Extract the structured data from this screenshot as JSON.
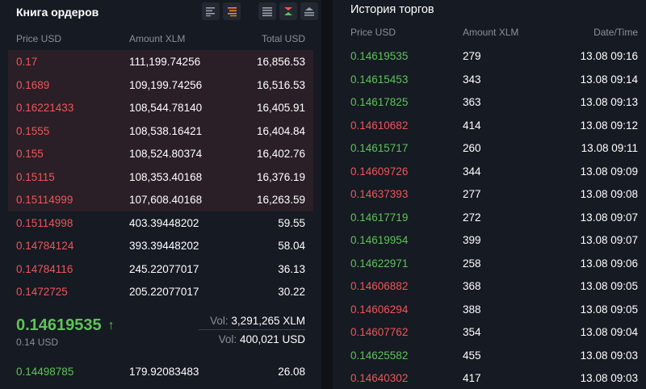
{
  "orderbook": {
    "title": "Книга ордеров",
    "columns": {
      "price": "Price USD",
      "amount": "Amount XLM",
      "total": "Total USD"
    },
    "asks": [
      {
        "price": "0.17",
        "amount": "111,199.74256",
        "total": "16,856.53",
        "highlight": true
      },
      {
        "price": "0.1689",
        "amount": "109,199.74256",
        "total": "16,516.53",
        "highlight": true
      },
      {
        "price": "0.16221433",
        "amount": "108,544.78140",
        "total": "16,405.91",
        "highlight": true
      },
      {
        "price": "0.1555",
        "amount": "108,538.16421",
        "total": "16,404.84",
        "highlight": true
      },
      {
        "price": "0.155",
        "amount": "108,524.80374",
        "total": "16,402.76",
        "highlight": true
      },
      {
        "price": "0.15115",
        "amount": "108,353.40168",
        "total": "16,376.19",
        "highlight": true
      },
      {
        "price": "0.15114999",
        "amount": "107,608.40168",
        "total": "16,263.59",
        "highlight": true
      },
      {
        "price": "0.15114998",
        "amount": "403.39448202",
        "total": "59.55",
        "highlight": false
      },
      {
        "price": "0.14784124",
        "amount": "393.39448202",
        "total": "58.04",
        "highlight": false
      },
      {
        "price": "0.14784116",
        "amount": "245.22077017",
        "total": "36.13",
        "highlight": false
      },
      {
        "price": "0.1472725",
        "amount": "205.22077017",
        "total": "30.22",
        "highlight": false
      }
    ],
    "last_price": "0.14619535",
    "last_price_arrow": "↑",
    "last_price_usd": "0.14 USD",
    "vol_label": "Vol:",
    "vol_xlm": "3,291,265 XLM",
    "vol_usd": "400,021 USD",
    "bids": [
      {
        "price": "0.14498785",
        "amount": "179.92083483",
        "total": "26.08"
      }
    ],
    "colors": {
      "ask": "#f0555a",
      "bid": "#5dc35a",
      "ask_highlight": "#2a1f26"
    }
  },
  "history": {
    "title": "История торгов",
    "columns": {
      "price": "Price USD",
      "amount": "Amount XLM",
      "time": "Date/Time"
    },
    "trades": [
      {
        "price": "0.14619535",
        "amount": "279",
        "time": "13.08 09:16",
        "side": "buy"
      },
      {
        "price": "0.14615453",
        "amount": "343",
        "time": "13.08 09:14",
        "side": "buy"
      },
      {
        "price": "0.14617825",
        "amount": "363",
        "time": "13.08 09:13",
        "side": "buy"
      },
      {
        "price": "0.14610682",
        "amount": "414",
        "time": "13.08 09:12",
        "side": "sell"
      },
      {
        "price": "0.14615717",
        "amount": "260",
        "time": "13.08 09:11",
        "side": "buy"
      },
      {
        "price": "0.14609726",
        "amount": "344",
        "time": "13.08 09:09",
        "side": "sell"
      },
      {
        "price": "0.14637393",
        "amount": "277",
        "time": "13.08 09:08",
        "side": "sell"
      },
      {
        "price": "0.14617719",
        "amount": "272",
        "time": "13.08 09:07",
        "side": "buy"
      },
      {
        "price": "0.14619954",
        "amount": "399",
        "time": "13.08 09:07",
        "side": "buy"
      },
      {
        "price": "0.14622971",
        "amount": "258",
        "time": "13.08 09:06",
        "side": "buy"
      },
      {
        "price": "0.14606882",
        "amount": "368",
        "time": "13.08 09:05",
        "side": "sell"
      },
      {
        "price": "0.14606294",
        "amount": "388",
        "time": "13.08 09:05",
        "side": "sell"
      },
      {
        "price": "0.14607762",
        "amount": "354",
        "time": "13.08 09:04",
        "side": "sell"
      },
      {
        "price": "0.14625582",
        "amount": "455",
        "time": "13.08 09:03",
        "side": "buy"
      },
      {
        "price": "0.14640302",
        "amount": "417",
        "time": "13.08 09:03",
        "side": "sell"
      }
    ]
  },
  "icons": {
    "tool1": "align-left-lines-icon",
    "tool2": "orange-lines-icon",
    "tool3": "orderbook-both-icon",
    "tool4": "orderbook-split-icon",
    "tool5": "orderbook-asks-icon"
  }
}
